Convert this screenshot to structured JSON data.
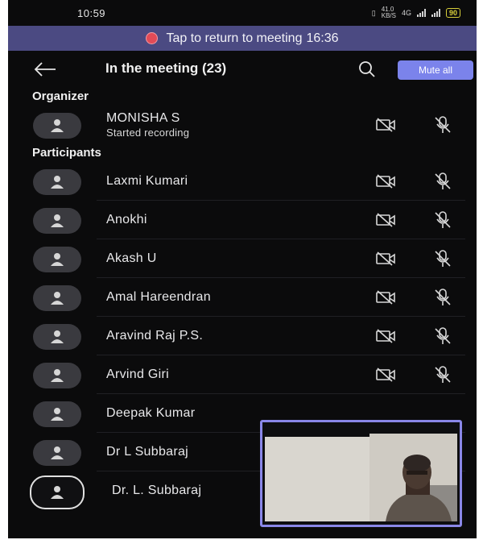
{
  "status_bar": {
    "time": "10:59",
    "net_speed": "41.0",
    "net_unit": "KB/S",
    "network": "4G",
    "battery": "90"
  },
  "return_banner": {
    "text": "Tap to return to meeting",
    "duration": "16:36"
  },
  "header": {
    "title": "In the meeting (23)",
    "back_icon": "arrow-left-icon",
    "search_icon": "search-icon",
    "mute_all_label": "Mute all"
  },
  "sections": {
    "organizer": "Organizer",
    "participants": "Participants"
  },
  "organizer": {
    "name": "MONISHA  S",
    "status": "Started recording"
  },
  "participants": [
    {
      "name": "Laxmi Kumari"
    },
    {
      "name": "Anokhi"
    },
    {
      "name": "Akash U"
    },
    {
      "name": "Amal Hareendran"
    },
    {
      "name": "Aravind Raj  P.S."
    },
    {
      "name": "Arvind Giri"
    },
    {
      "name": "Deepak Kumar"
    },
    {
      "name": "Dr L Subbaraj"
    },
    {
      "name": "Dr. L. Subbaraj"
    }
  ],
  "icons": {
    "camera": "camera-off-icon",
    "mic": "mic-off-icon",
    "avatar": "person-icon"
  },
  "colors": {
    "background": "#0b0b0c",
    "banner": "#4b4a82",
    "accent": "#7b83eb",
    "record": "#e14b57"
  }
}
